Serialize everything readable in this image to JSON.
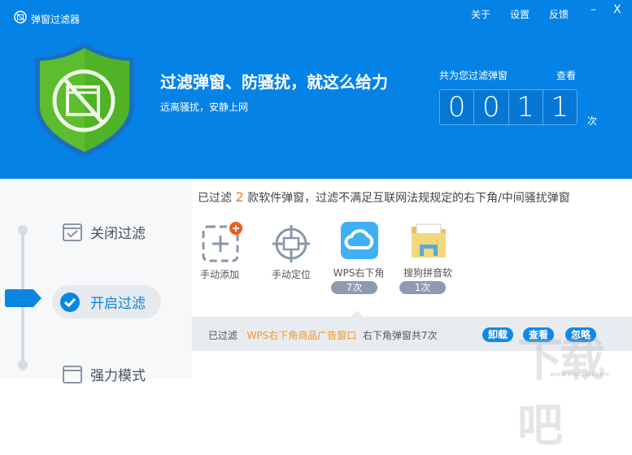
{
  "app": {
    "title": "弹窗过滤器",
    "menu": {
      "about": "关于",
      "settings": "设置",
      "feedback": "反馈"
    },
    "minimize": "–",
    "close": "X"
  },
  "hero": {
    "headline": "过滤弹窗、防骚扰，就这么给力",
    "subline": "远离骚扰，安静上网",
    "counter_label": "共为您过滤弹窗",
    "view_link": "查看",
    "digits": [
      "0",
      "0",
      "1",
      "1"
    ],
    "unit": "次"
  },
  "sidebar": {
    "items": [
      {
        "label": "关闭过滤"
      },
      {
        "label": "开启过滤",
        "active": true
      },
      {
        "label": "强力模式"
      }
    ]
  },
  "main": {
    "summary_prefix": "已过滤 ",
    "summary_count": "2",
    "summary_suffix": " 款软件弹窗，过滤不满足互联网法规规定的右下角/中间骚扰弹窗",
    "tools": [
      {
        "label": "手动添加",
        "icon": "add-icon"
      },
      {
        "label": "手动定位",
        "icon": "crosshair-icon"
      }
    ],
    "apps": [
      {
        "label": "WPS右下角",
        "badge": "7次",
        "icon": "cloud-icon"
      },
      {
        "label": "搜狗拼音软",
        "badge": "1次",
        "icon": "folder-icon"
      }
    ],
    "detail": {
      "prefix": "已过滤",
      "name": "WPS右下角商品广告窗口",
      "suffix": "右下角弹窗共7次",
      "buttons": {
        "uninstall": "卸载",
        "view": "查看",
        "ignore": "忽略"
      }
    }
  },
  "watermark": {
    "text": "下载吧",
    "url": "www.xiazaiba.com"
  },
  "colors": {
    "header": "#0582e6",
    "accent": "#f07a1a",
    "button": "#1088e6",
    "shield": "#5cbd2e"
  }
}
